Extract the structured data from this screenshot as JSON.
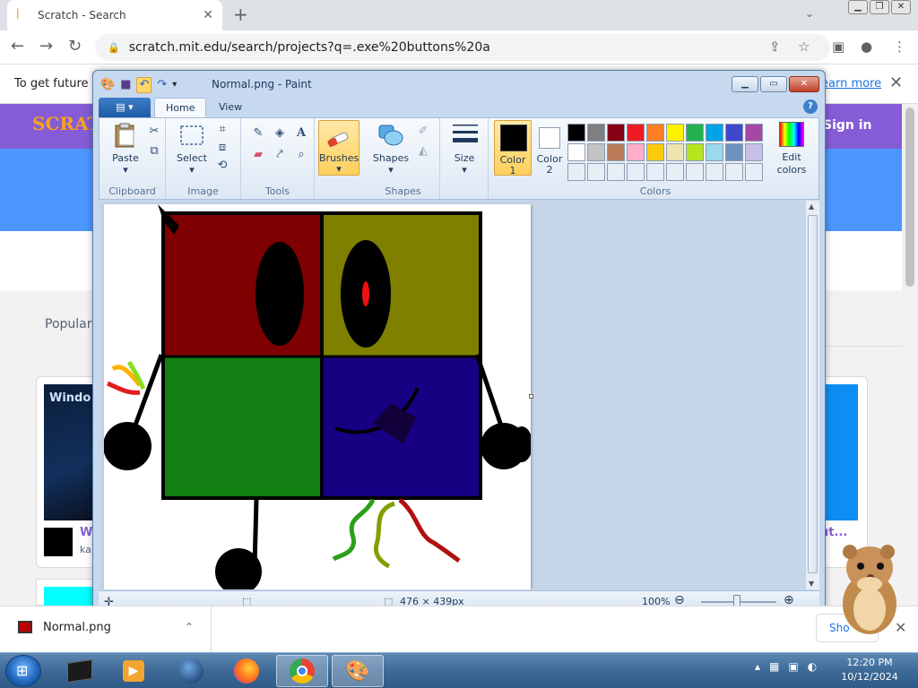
{
  "browser": {
    "tab_title": "Scratch - Search",
    "tab_close": "✕",
    "new_tab": "+",
    "url": "scratch.mit.edu/search/projects?q=.exe%20buttons%20a",
    "infobar_message": "To get future G",
    "infobar_link": "earn more",
    "infobar_close": "✕"
  },
  "scratch": {
    "logo": "SCRATCH",
    "sign_in": "Sign in",
    "popular": "Popular",
    "card1_thumb_text": "Windo",
    "card1_title": "W",
    "card1_author": "ka",
    "card2_title": "ut..."
  },
  "paint": {
    "window_title": "Normal.png - Paint",
    "tabs": {
      "home": "Home",
      "view": "View"
    },
    "help": "?",
    "groups": {
      "clipboard": "Clipboard",
      "image": "Image",
      "tools": "Tools",
      "shapes": "Shapes",
      "colors": "Colors"
    },
    "buttons": {
      "paste": "Paste",
      "select": "Select",
      "brushes": "Brushes",
      "shapes": "Shapes",
      "size": "Size",
      "color1_line1": "Color",
      "color1_line2": "1",
      "color2_line1": "Color",
      "color2_line2": "2",
      "edit_colors_line1": "Edit",
      "edit_colors_line2": "colors"
    },
    "color1": "#000000",
    "color2": "#ffffff",
    "palette": [
      "#000000",
      "#7f7f7f",
      "#880015",
      "#ed1c24",
      "#ff7f27",
      "#fff200",
      "#22b14c",
      "#00a2e8",
      "#3f48cc",
      "#a349a4",
      "#ffffff",
      "#c3c3c3",
      "#b97a57",
      "#ffaec9",
      "#ffc90e",
      "#efe4b0",
      "#b5e61d",
      "#99d9ea",
      "#7092be",
      "#c8bfe7",
      "#e8eef6",
      "#e8eef6",
      "#e8eef6",
      "#e8eef6",
      "#e8eef6",
      "#e8eef6",
      "#e8eef6",
      "#e8eef6",
      "#e8eef6",
      "#e8eef6"
    ],
    "status": {
      "dimensions": "476 × 439px",
      "zoom": "100%"
    }
  },
  "downloads": {
    "file": "Normal.png",
    "show_all": "Sho",
    "close": "✕"
  },
  "taskbar": {
    "time": "12:20 PM",
    "date": "10/12/2024"
  }
}
